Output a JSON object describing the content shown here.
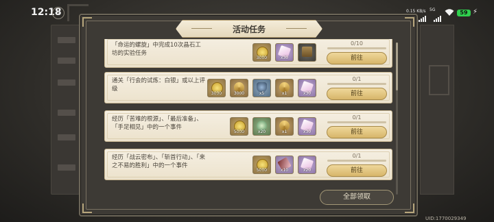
{
  "status_bar": {
    "time": "12:18",
    "net_speed": "0.15 KB/s",
    "net_type": "5G",
    "net_type_2": "5G",
    "battery": "59"
  },
  "dialog": {
    "title": "活动任务",
    "claim_all_label": "全部领取"
  },
  "quests": [
    {
      "description": "「命运的螺旋」中完成10次晶石工坊的实验任务",
      "progress": "0/10",
      "button": "前往",
      "rewards": [
        {
          "icon": "gold-coin-icon",
          "style": "r-gold",
          "amount": "3000"
        },
        {
          "icon": "ticket-icon",
          "style": "r-purple",
          "amount": "x30"
        },
        {
          "icon": "treasure-chest-icon",
          "style": "r-dark",
          "amount": ""
        }
      ]
    },
    {
      "description": "通关「行会的试炼：白银」或以上评级",
      "progress": "0/1",
      "button": "前往",
      "rewards": [
        {
          "icon": "gold-coin-icon",
          "style": "r-gold",
          "amount": "3000"
        },
        {
          "icon": "pile-material-icon",
          "style": "r-tan",
          "amount": "3000"
        },
        {
          "icon": "helmet-icon",
          "style": "r-blue",
          "amount": "x5"
        },
        {
          "icon": "cog-medal-icon",
          "style": "r-tan",
          "amount": "x1"
        },
        {
          "icon": "ticket-icon",
          "style": "r-purple",
          "amount": "x30"
        }
      ]
    },
    {
      "description": "经历「苦难的根源」、「最后准备」、「手足相见」中的一个事件",
      "progress": "0/1",
      "button": "前往",
      "rewards": [
        {
          "icon": "gold-coin-icon",
          "style": "r-gold",
          "amount": "5000"
        },
        {
          "icon": "potion-icon",
          "style": "r-green",
          "amount": "x20"
        },
        {
          "icon": "cog-medal-icon",
          "style": "r-tan",
          "amount": "x1"
        },
        {
          "icon": "ticket-icon",
          "style": "r-purple",
          "amount": "x30"
        }
      ]
    },
    {
      "description": "经历「战云密布」、「斩首行动」、「来之不易的胜利」中的一个事件",
      "progress": "0/1",
      "button": "前往",
      "rewards": [
        {
          "icon": "gold-coin-icon",
          "style": "r-gold",
          "amount": "5000"
        },
        {
          "icon": "scroll-icon",
          "style": "r-lilac",
          "amount": "x10"
        },
        {
          "icon": "ticket-icon",
          "style": "r-purple",
          "amount": "x20"
        }
      ]
    }
  ],
  "footer": {
    "uid": "UID:1770029349"
  }
}
